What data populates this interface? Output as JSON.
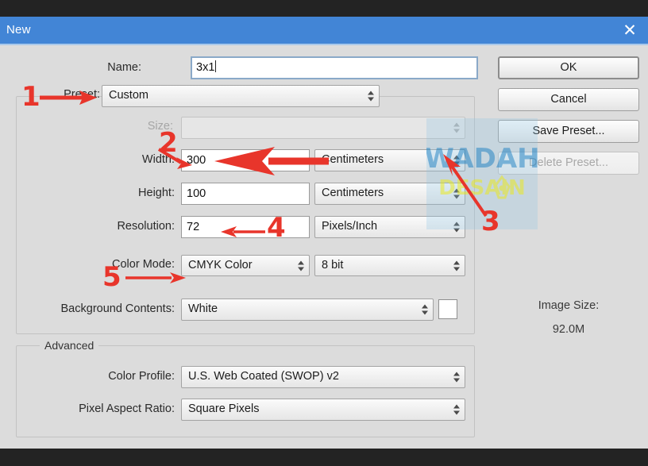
{
  "window": {
    "title": "New",
    "close_icon": "close-icon"
  },
  "form": {
    "name_label": "Name:",
    "name_value": "3x1",
    "preset_label": "Preset:",
    "preset_value": "Custom",
    "size_label": "Size:",
    "size_value": "",
    "width_label": "Width:",
    "width_value": "300",
    "width_unit": "Centimeters",
    "height_label": "Height:",
    "height_value": "100",
    "height_unit": "Centimeters",
    "resolution_label": "Resolution:",
    "resolution_value": "72",
    "resolution_unit": "Pixels/Inch",
    "color_mode_label": "Color Mode:",
    "color_mode_value": "CMYK Color",
    "color_depth_value": "8 bit",
    "background_label": "Background Contents:",
    "background_value": "White",
    "background_swatch_color": "#ffffff"
  },
  "advanced": {
    "group_title": "Advanced",
    "color_profile_label": "Color Profile:",
    "color_profile_value": "U.S. Web Coated (SWOP) v2",
    "pixel_aspect_label": "Pixel Aspect Ratio:",
    "pixel_aspect_value": "Square Pixels"
  },
  "buttons": {
    "ok": "OK",
    "cancel": "Cancel",
    "save_preset": "Save Preset...",
    "delete_preset": "Delete Preset..."
  },
  "image_size": {
    "label": "Image Size:",
    "value": "92.0M"
  },
  "annotations": {
    "marker_1": "1",
    "marker_2": "2",
    "marker_3": "3",
    "marker_4": "4",
    "marker_5": "5",
    "color": "#e8352b"
  },
  "watermark": {
    "line1": "WADAH",
    "line2": "DESAIN",
    "color1": "#2e8bc8",
    "color2": "#d8e23a"
  },
  "colors": {
    "titlebar": "#4285d6",
    "dialog_bg": "#dcdcdc",
    "chrome": "#232323",
    "accent_red": "#e8352b"
  }
}
